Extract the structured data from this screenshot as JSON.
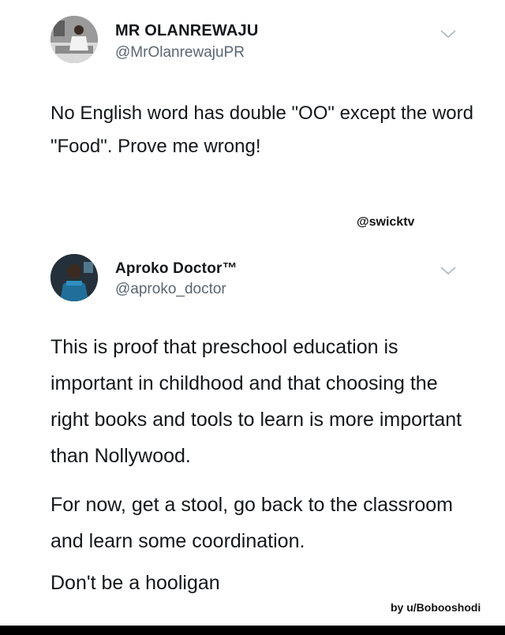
{
  "tweets": [
    {
      "display_name": "MR OLANREWAJU",
      "handle": "@MrOlanrewajuPR",
      "text": "No English word has double \"OO\" except the word \"Food\".  Prove me wrong!",
      "menu_icon": "chevron-down-icon"
    },
    {
      "display_name": "Aproko Doctor™",
      "handle": "@aproko_doctor",
      "paragraphs": [
        "This is proof that preschool education is important in childhood and that choosing the right books and tools to learn is more important than Nollywood.",
        "For now, get a stool, go back to the classroom and learn some coordination.",
        "Don't be a hooligan"
      ],
      "menu_icon": "chevron-down-icon"
    }
  ],
  "watermarks": {
    "top": "@swicktv",
    "bottom": "by u/Bobooshodi"
  }
}
